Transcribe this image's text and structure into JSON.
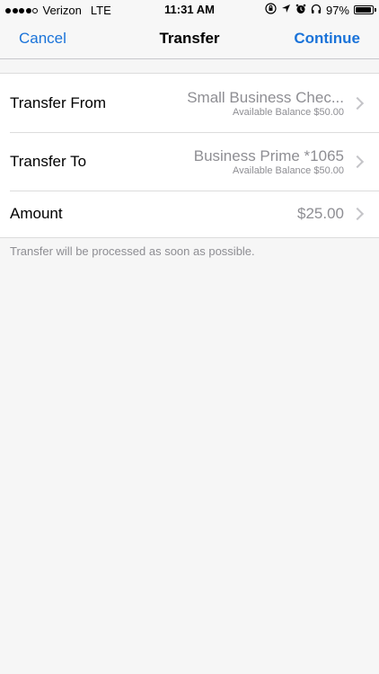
{
  "status_bar": {
    "carrier": "Verizon",
    "network": "LTE",
    "time": "11:31 AM",
    "battery_percent": "97%",
    "battery_level": 0.97,
    "signal_bars_filled": 4,
    "signal_bars_total": 5
  },
  "nav": {
    "cancel_label": "Cancel",
    "title": "Transfer",
    "continue_label": "Continue"
  },
  "form": {
    "from": {
      "label": "Transfer From",
      "value": "Small Business Chec...",
      "subvalue": "Available Balance $50.00"
    },
    "to": {
      "label": "Transfer To",
      "value": "Business Prime *1065",
      "subvalue": "Available Balance $50.00"
    },
    "amount": {
      "label": "Amount",
      "value": "$25.00"
    }
  },
  "footnote": "Transfer will be processed as soon as possible.",
  "colors": {
    "accent": "#1a73d9",
    "secondary_text": "#8e8e93",
    "background": "#f6f6f6"
  }
}
